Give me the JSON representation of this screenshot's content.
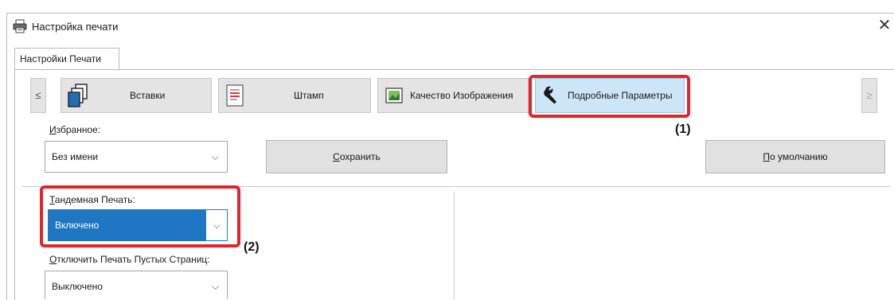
{
  "window": {
    "title": "Настройка печати",
    "close_glyph": "✕"
  },
  "tabs": [
    {
      "label": "Настройки Печати"
    }
  ],
  "ribbon": {
    "left_arrow": "≤",
    "right_arrow": "≥",
    "items": [
      {
        "label": "Вставки",
        "icon": "inserts-pages-icon"
      },
      {
        "label": "Штамп",
        "icon": "stamp-icon"
      },
      {
        "label": "Качество Изображения",
        "icon": "image-quality-icon"
      },
      {
        "label": "Подробные Параметры",
        "icon": "wrench-icon",
        "selected": true
      }
    ]
  },
  "favorites": {
    "label_underlined": "И",
    "label_rest": "збранное:",
    "value": "Без имени",
    "save_underlined": "С",
    "save_rest": "охранить",
    "default_underlined": "П",
    "default_rest": "о умолчанию"
  },
  "tandem": {
    "label_underlined": "Т",
    "label_rest": "андемная Печать:",
    "value": "Включено"
  },
  "blank_pages": {
    "label_underlined": "О",
    "label_rest": "тключить Печать Пустых Страниц:",
    "value": "Выключено"
  },
  "callouts": {
    "one": "(1)",
    "two": "(2)"
  },
  "colors": {
    "callout": "#e2242b",
    "selected_tab": "#cde6f7",
    "active_select": "#1f77c4"
  }
}
